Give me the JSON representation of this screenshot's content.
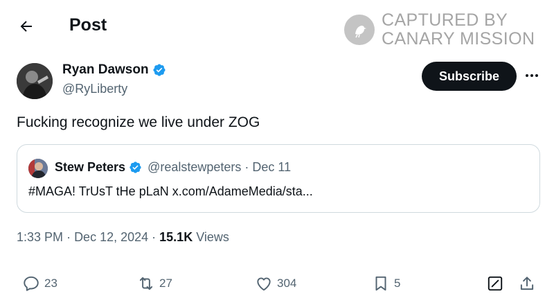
{
  "header": {
    "title": "Post"
  },
  "watermark": {
    "line1": "CAPTURED BY",
    "line2": "CANARY MISSION"
  },
  "post": {
    "author_name": "Ryan Dawson",
    "author_handle": "@RyLiberty",
    "subscribe_label": "Subscribe",
    "text": "Fucking recognize we live under ZOG",
    "time": "1:33 PM",
    "date": "Dec 12, 2024",
    "views_count": "15.1K",
    "views_label": "Views"
  },
  "quote": {
    "author_name": "Stew Peters",
    "author_handle": "@realstewpeters",
    "date": "Dec 11",
    "text": "#MAGA! TrUsT tHe pLaN x.com/AdameMedia/sta..."
  },
  "actions": {
    "replies": "23",
    "reposts": "27",
    "likes": "304",
    "bookmarks": "5"
  },
  "icons": {
    "back": "arrow-left-icon",
    "verified": "verified-badge-icon",
    "more": "more-horizontal-icon",
    "reply": "reply-icon",
    "repost": "repost-icon",
    "like": "heart-icon",
    "bookmark": "bookmark-icon",
    "grok": "grok-icon",
    "share": "share-icon"
  },
  "colors": {
    "verified": "#1d9bf0",
    "text": "#0f1419",
    "muted": "#536471",
    "border": "#cfd9de",
    "watermark": "#a5a5a5"
  }
}
